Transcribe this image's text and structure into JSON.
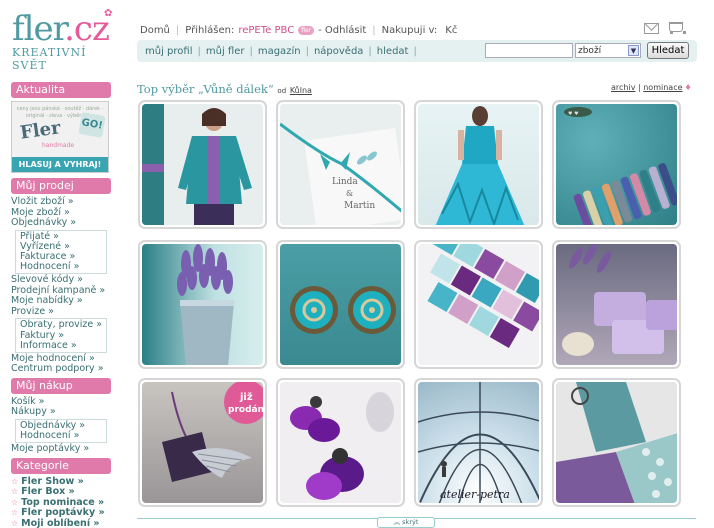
{
  "logo": {
    "main": "fler",
    "dot": ".cz",
    "sub": "KREATIVNÍ SVĚT"
  },
  "topbar": {
    "home": "Domů",
    "logged_in_label": "Přihlášen:",
    "user": "rePETe PBC",
    "badge": "fler",
    "logout": "- Odhlásit",
    "currency_label": "Nakupuji v:",
    "currency": "Kč"
  },
  "nav": {
    "items": [
      "můj profil",
      "můj fler",
      "magazín",
      "nápověda",
      "hledat"
    ],
    "search_value": "",
    "select_value": "zboží",
    "search_button": "Hledat"
  },
  "sidebar": {
    "aktualita": "Aktualita",
    "promo": {
      "small": "ceny jsou pánské · soutěž · dárek · originál · sleva · výběr · fler",
      "big": "Fler",
      "go": "GO!",
      "hand": "handmade",
      "cta": "HLASUJ A VYHRAJ!"
    },
    "muj_prodej": "Můj prodej",
    "prodej_links": [
      "Vložit zboží »",
      "Moje zboží »",
      "Objednávky »"
    ],
    "objednavky_sub": [
      "Přijaté »",
      "Vyřízené »",
      "Fakturace »",
      "Hodnocení »"
    ],
    "prodej_links2": [
      "Slevové kódy »",
      "Prodejní kampaně »",
      "Moje nabídky »",
      "Provize »"
    ],
    "provize_sub": [
      "Obraty, provize »",
      "Faktury »",
      "Informace »"
    ],
    "prodej_links3": [
      "Moje hodnocení »",
      "Centrum podpory »"
    ],
    "muj_nakup": "Můj nákup",
    "nakup_links": [
      "Košík »",
      "Nákupy »"
    ],
    "nakupy_sub": [
      "Objednávky »",
      "Hodnocení »"
    ],
    "nakup_links2": [
      "Moje poptávky »"
    ],
    "kategorie": "Kategorie",
    "kategorie_links": [
      "Fler Show »",
      "Fler Box »",
      "Top nominace »",
      "Fler poptávky »",
      "Moji oblíbení »"
    ]
  },
  "main": {
    "title": "Top výběr „Vůně dálek“",
    "od": "od",
    "author": "Kůlna",
    "archiv": "archiv",
    "nominace": "nominace",
    "sold_label_1": "již",
    "sold_label_2": "prodáno",
    "atelier": "atelier-petra",
    "invitation_1": "Linda",
    "invitation_2": "&",
    "invitation_3": "Martin",
    "hide": "skrýt"
  },
  "colors": {
    "pink": "#e07aaa",
    "teal": "#4f9aa0",
    "nav_bg": "#e5f0f0"
  }
}
